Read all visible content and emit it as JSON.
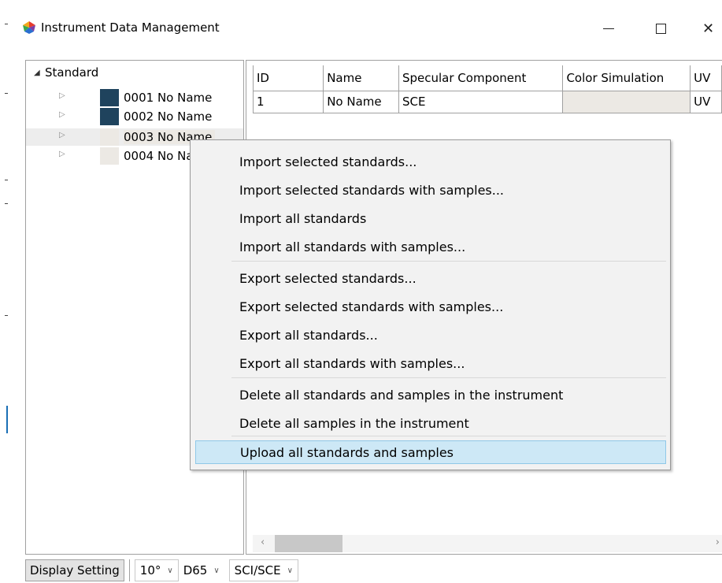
{
  "window": {
    "title": "Instrument Data Management"
  },
  "tree": {
    "root_label": "Standard",
    "items": [
      {
        "label": "0001  No Name",
        "swatch": "#1f435d"
      },
      {
        "label": "0002  No Name",
        "swatch": "#1f435d"
      },
      {
        "label": "0003  No Name",
        "swatch": "#ece9e4"
      },
      {
        "label": "0004  No Name",
        "swatch": "#ece9e4"
      }
    ]
  },
  "grid": {
    "columns": [
      "ID",
      "Name",
      "Specular Component",
      "Color Simulation",
      "UV"
    ],
    "rows": [
      {
        "id": "1",
        "name": "No Name",
        "specular": "SCE",
        "color_sim": "",
        "uv": "UV"
      }
    ],
    "color_sim_fill": "#ece9e4"
  },
  "context_menu": {
    "items": [
      "Import selected standards...",
      "Import selected standards with samples...",
      "Import all standards",
      "Import all standards with samples...",
      "Export selected standards...",
      "Export selected standards with samples...",
      "Export all standards...",
      "Export all standards with samples...",
      "Delete all standards and samples in the instrument",
      "Delete all samples in the instrument",
      "Upload all standards and samples"
    ],
    "highlighted_index": 10,
    "highlight_color": "#cde8f6"
  },
  "toolbar": {
    "display_setting_label": "Display Setting",
    "observer_value": "10°",
    "illuminant_value": "D65",
    "mode_value": "SCI/SCE"
  },
  "icons": {
    "app": "palette-icon",
    "minimize": "minimize-icon",
    "maximize": "maximize-icon",
    "close": "close-icon"
  }
}
